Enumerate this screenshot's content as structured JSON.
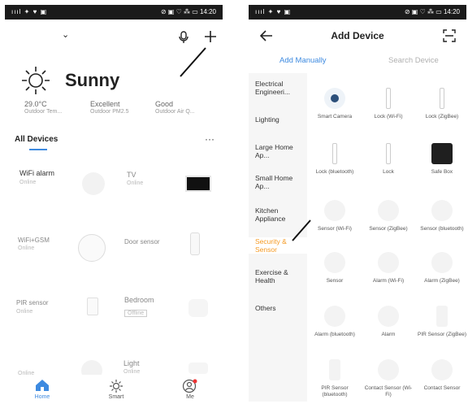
{
  "left": {
    "status": {
      "left": "ıııl ✦ ♥ ▣",
      "right": "⊘ ▣ ♡ ⁂ ▭ 14:20"
    },
    "weather": {
      "condition": "Sunny",
      "temp_value": "29.0°C",
      "temp_label": "Outdoor Tem...",
      "pm_value": "Excellent",
      "pm_label": "Outdoor PM2.5",
      "air_value": "Good",
      "air_label": "Outdoor Air Q..."
    },
    "section_title": "All Devices",
    "more": "···",
    "devices": [
      {
        "name": "WiFi alarm",
        "status": "Online"
      },
      {
        "name": "TV",
        "status": "Online"
      },
      {
        "name": "WiFi+GSM",
        "status": "Online"
      },
      {
        "name": "Door sensor",
        "status": ""
      },
      {
        "name": "PIR sensor",
        "status": "Online"
      },
      {
        "name": "Bedroom",
        "status": "Offline"
      },
      {
        "name": "",
        "status": "Online"
      },
      {
        "name": "Light",
        "status": "Online"
      }
    ],
    "tabs": [
      {
        "label": "Home"
      },
      {
        "label": "Smart"
      },
      {
        "label": "Me"
      }
    ]
  },
  "right": {
    "status": {
      "left": "ıııl ✦ ♥ ▣",
      "right": "⊘ ▣ ♡ ⁂ ▭ 14:20"
    },
    "title": "Add Device",
    "tabs": {
      "manual": "Add Manually",
      "search": "Search Device"
    },
    "categories": [
      {
        "label": "Electrical Engineeri...",
        "active": false
      },
      {
        "label": "Lighting",
        "active": false
      },
      {
        "label": "Large Home Ap...",
        "active": false
      },
      {
        "label": "Small Home Ap...",
        "active": false
      },
      {
        "label": "Kitchen Appliance",
        "active": false
      },
      {
        "label": "Security & Sensor",
        "active": true
      },
      {
        "label": "Exercise & Health",
        "active": false
      },
      {
        "label": "Others",
        "active": false
      }
    ],
    "items": [
      {
        "label": "Smart Camera"
      },
      {
        "label": "Lock (Wi-Fi)"
      },
      {
        "label": "Lock (ZigBee)"
      },
      {
        "label": "Lock (bluetooth)"
      },
      {
        "label": "Lock"
      },
      {
        "label": "Safe Box"
      },
      {
        "label": "Sensor (Wi-Fi)"
      },
      {
        "label": "Sensor (ZigBee)"
      },
      {
        "label": "Sensor (bluetooth)"
      },
      {
        "label": "Sensor"
      },
      {
        "label": "Alarm (Wi-Fi)"
      },
      {
        "label": "Alarm (ZigBee)"
      },
      {
        "label": "Alarm (bluetooth)"
      },
      {
        "label": "Alarm"
      },
      {
        "label": "PIR Sensor (ZigBee)"
      },
      {
        "label": "PIR Sensor (bluetooth)"
      },
      {
        "label": "Contact Sensor (Wi-Fi)"
      },
      {
        "label": "Contact Sensor"
      }
    ]
  }
}
